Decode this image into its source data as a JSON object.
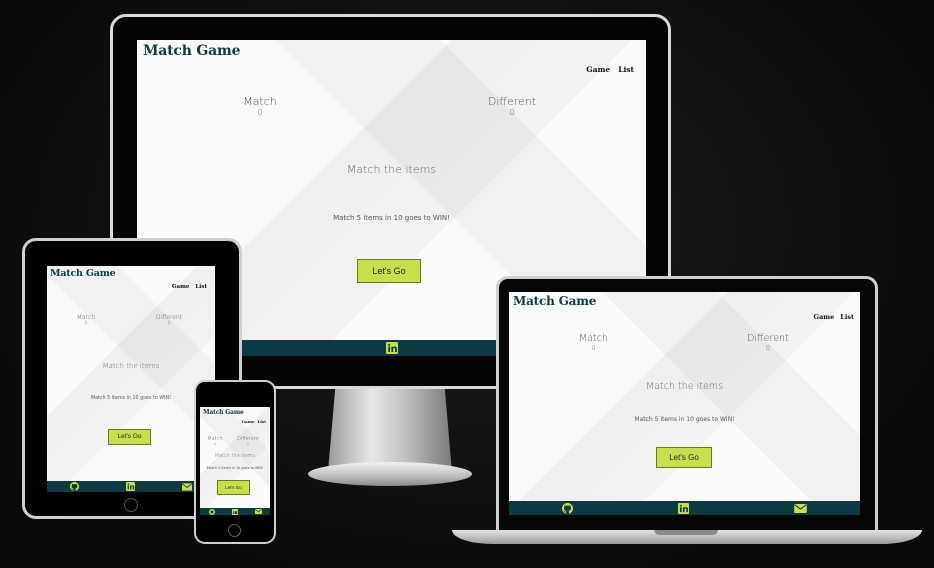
{
  "app": {
    "logo": "Match Game",
    "nav": [
      "Game",
      "List"
    ],
    "match_label": "Match",
    "match_value": "0",
    "different_label": "Different",
    "different_value": "0",
    "heading": "Match the items",
    "subtext": "Match 5 items in 10 goes to WIN!",
    "button_label": "Let's Go",
    "footer_icons": [
      "github-icon",
      "linkedin-icon",
      "envelope-icon"
    ]
  },
  "colors": {
    "brand_dark": "#0d3b41",
    "button": "#c7e04a",
    "background": "#0c0c0c"
  }
}
